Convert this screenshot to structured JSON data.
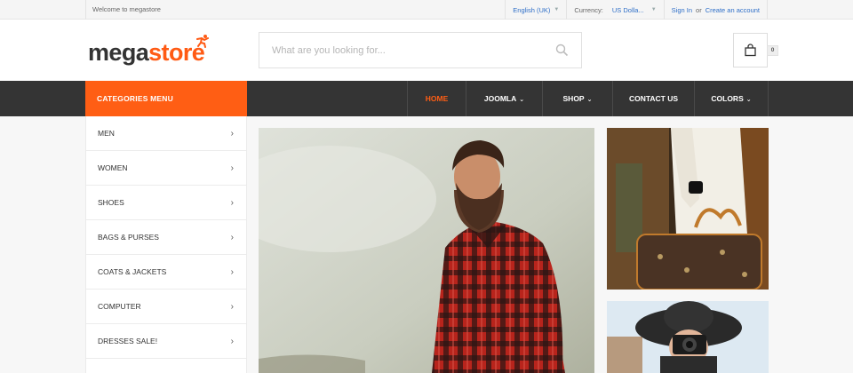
{
  "topbar": {
    "welcome": "Welcome to megastore",
    "language": "English (UK)",
    "currency_label": "Currency:",
    "currency_value": "US Dolla...",
    "sign_in": "Sign In",
    "or": "or",
    "create_account": "Create an account"
  },
  "logo": {
    "part1": "mega",
    "part2": "store"
  },
  "search": {
    "placeholder": "What are you looking for..."
  },
  "cart": {
    "count": "0"
  },
  "nav": {
    "categories_label": "CATEGORIES MENU",
    "items": [
      {
        "label": "HOME",
        "active": true,
        "dropdown": false
      },
      {
        "label": "JOOMLA",
        "active": false,
        "dropdown": true
      },
      {
        "label": "SHOP",
        "active": false,
        "dropdown": true
      },
      {
        "label": "CONTACT US",
        "active": false,
        "dropdown": false
      },
      {
        "label": "COLORS",
        "active": false,
        "dropdown": true
      }
    ]
  },
  "sidebar": {
    "items": [
      {
        "label": "MEN"
      },
      {
        "label": "WOMEN"
      },
      {
        "label": "SHOES"
      },
      {
        "label": "BAGS & PURSES"
      },
      {
        "label": "COATS & JACKETS"
      },
      {
        "label": "COMPUTER"
      },
      {
        "label": "DRESSES SALE!"
      }
    ]
  },
  "colors": {
    "accent": "#ff5e14",
    "nav_bg": "#343434",
    "link": "#2f6fc8"
  },
  "icons": {
    "search": "search-icon",
    "cart": "shopping-bag-icon",
    "chevron": "chevron-right-icon"
  }
}
